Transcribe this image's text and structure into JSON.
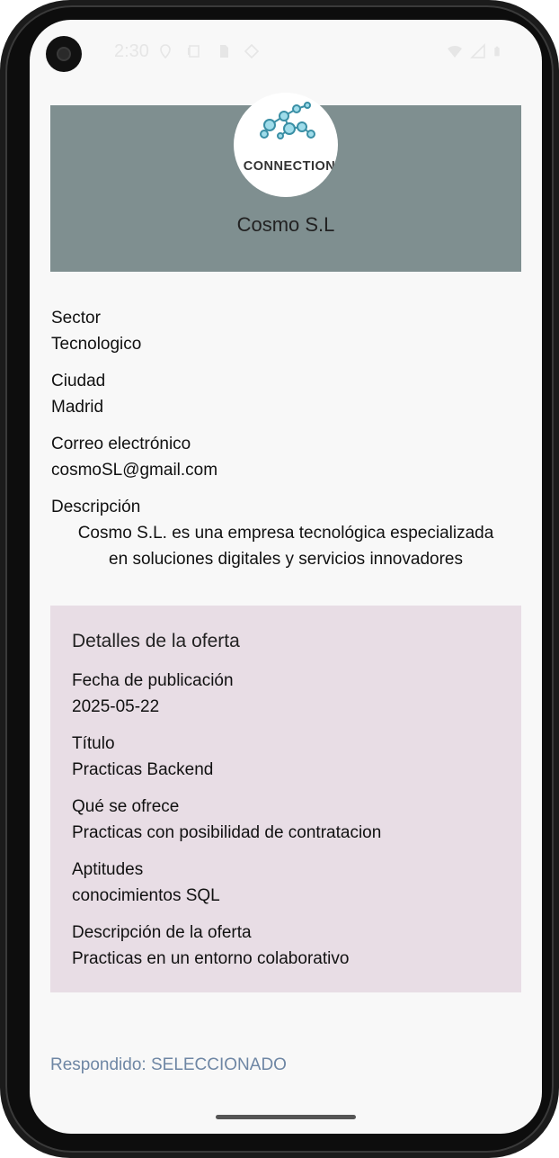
{
  "status_bar": {
    "time": "2:30"
  },
  "company": {
    "logo_text": "CONNECTION",
    "name": "Cosmo S.L"
  },
  "fields": [
    {
      "label": "Sector",
      "value": "Tecnologico"
    },
    {
      "label": "Ciudad",
      "value": "Madrid"
    },
    {
      "label": "Correo electrónico",
      "value": "cosmoSL@gmail.com"
    }
  ],
  "description": {
    "label": "Descripción",
    "line1": "Cosmo S.L. es una empresa tecnológica especializada",
    "line2": "en soluciones digitales y servicios innovadores"
  },
  "offer": {
    "title": "Detalles de la oferta",
    "items": [
      {
        "label": "Fecha de publicación",
        "value": "2025-05-22"
      },
      {
        "label": "Título",
        "value": "Practicas Backend"
      },
      {
        "label": "Qué se ofrece",
        "value": "Practicas con posibilidad de contratacion"
      },
      {
        "label": "Aptitudes",
        "value": "conocimientos SQL"
      },
      {
        "label": "Descripción de la oferta",
        "value": "Practicas en un entorno colaborativo"
      }
    ]
  },
  "response": {
    "text": "Respondido: SELECCIONADO",
    "color": "#6e86a4"
  },
  "colors": {
    "header_bg": "#7f8f90",
    "offer_bg": "#e8dde5",
    "screen_bg": "#f8f8f8"
  }
}
